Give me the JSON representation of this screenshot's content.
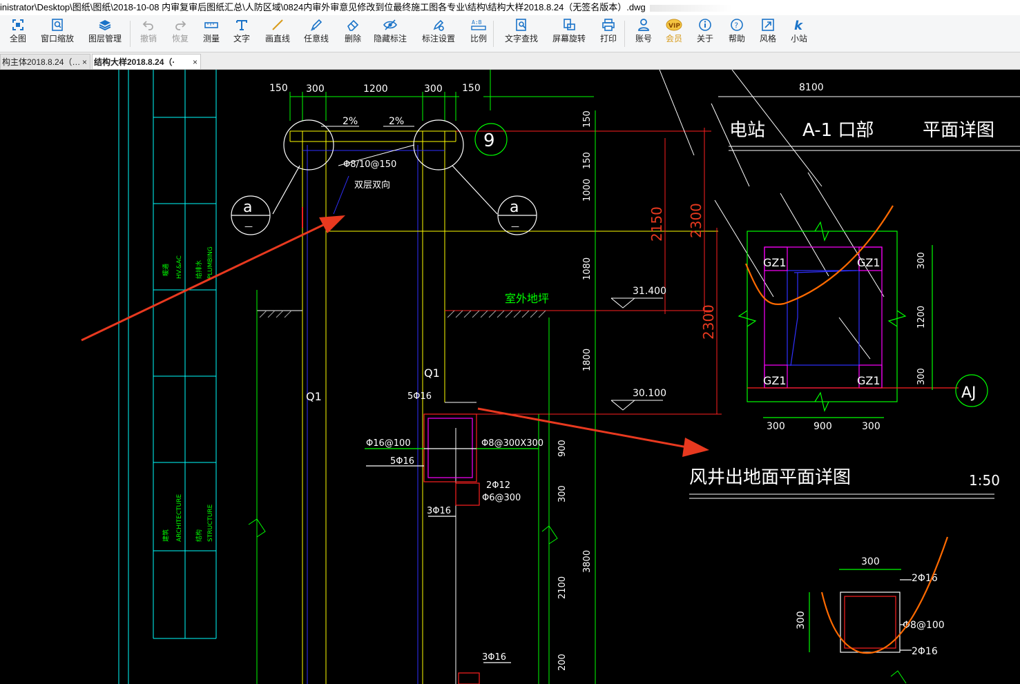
{
  "window": {
    "title": "inistrator\\Desktop\\图纸\\图纸\\2018-10-08 内审复审后图纸汇总\\人防区域\\0824内审外审意见修改到位最终施工图各专业\\结构\\结构大样2018.8.24（无签名版本）.dwg"
  },
  "toolbar": [
    {
      "label": "全图",
      "icon": "fit-all-icon"
    },
    {
      "label": "窗口缩放",
      "icon": "window-zoom-icon"
    },
    {
      "label": "图层管理",
      "icon": "layers-icon"
    },
    {
      "label": "撤销",
      "icon": "undo-icon"
    },
    {
      "label": "恢复",
      "icon": "redo-icon"
    },
    {
      "label": "测量",
      "icon": "ruler-icon"
    },
    {
      "label": "文字",
      "icon": "text-icon"
    },
    {
      "label": "画直线",
      "icon": "line-icon"
    },
    {
      "label": "任意线",
      "icon": "pen-icon"
    },
    {
      "label": "删除",
      "icon": "eraser-icon"
    },
    {
      "label": "隐藏标注",
      "icon": "eye-hide-icon"
    },
    {
      "label": "标注设置",
      "icon": "annotation-settings-icon"
    },
    {
      "label": "比例",
      "icon": "scale-icon"
    },
    {
      "label": "文字查找",
      "icon": "text-search-icon"
    },
    {
      "label": "屏幕旋转",
      "icon": "rotate-screen-icon"
    },
    {
      "label": "打印",
      "icon": "printer-icon"
    },
    {
      "label": "账号",
      "icon": "user-icon"
    },
    {
      "label": "会员",
      "icon": "vip-icon"
    },
    {
      "label": "关于",
      "icon": "info-icon"
    },
    {
      "label": "帮助",
      "icon": "help-icon"
    },
    {
      "label": "风格",
      "icon": "style-icon"
    },
    {
      "label": "小站",
      "icon": "k-station-icon"
    }
  ],
  "tabs": [
    {
      "label": "构主体2018.8.24（…",
      "close": "×"
    },
    {
      "label": "结构大样2018.8.24（·",
      "close": "×"
    }
  ],
  "colors": {
    "dim": "#ffffff",
    "wall": "#ffff00",
    "green": "#00ff00",
    "red": "#ff2020",
    "magenta": "#ff00ff",
    "blue": "#3030ff",
    "cyan": "#00ffff",
    "annot": "#e8391f",
    "orange": "#ff6a00"
  },
  "drawing": {
    "top_dims": [
      "150",
      "300",
      "1200",
      "300",
      "150"
    ],
    "slopes": [
      "2%",
      "2%"
    ],
    "rebar_top": "Φ8/10@150",
    "rebar_top_note": "双层双向",
    "section_mark": "a",
    "section_mark_sub": "—",
    "axis_9": "9",
    "vert_dims_left": [
      "150",
      "150",
      "1000",
      "1080",
      "1800"
    ],
    "vert_dims_mid": [
      "2150",
      "2300",
      "2300"
    ],
    "elev_1": "31.400",
    "elev_2": "30.100",
    "outdoor_ground": "室外地坪",
    "wall_q1": "Q1",
    "beam_labels": [
      "5Φ16",
      "Φ16@100",
      "5Φ16",
      "Φ8@300X300",
      "2Φ12",
      "Φ6@300",
      "3Φ16",
      "3Φ16",
      "5Φ16"
    ],
    "right_vert_dims": [
      "900",
      "300",
      "2100",
      "3800",
      "200"
    ],
    "plan_dim_top": "8100",
    "plan_title_words": [
      "电站",
      "A-1 口部",
      "平面详图"
    ],
    "plan_gz": [
      "GZ1",
      "GZ1",
      "GZ1",
      "GZ1"
    ],
    "plan_side_dims": [
      "300",
      "1200",
      "300"
    ],
    "plan_bottom_dims": [
      "300",
      "900",
      "300"
    ],
    "axis_aj": "AJ",
    "shaft_title": "风井出地面平面详图",
    "shaft_scale": "1:50",
    "col_dim_top": "300",
    "col_dim_side": "300",
    "col_rebar": [
      "2Φ16",
      "Φ8@100",
      "2Φ16"
    ],
    "title_block": [
      "暖通",
      "HV.&AC",
      "给排水",
      "PLUMBING",
      "建筑",
      "ARCHITECTURE",
      "结构",
      "STRUCTURE"
    ]
  }
}
